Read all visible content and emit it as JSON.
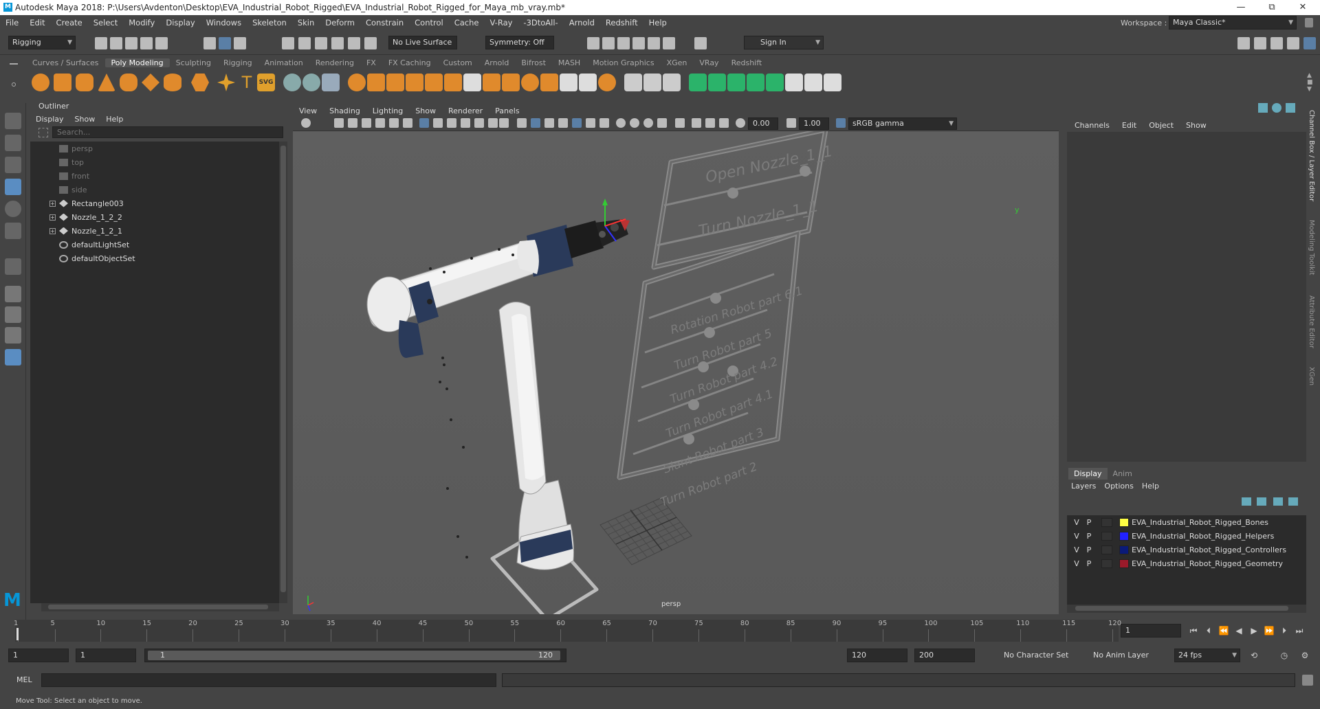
{
  "titlebar": {
    "title": "Autodesk Maya 2018: P:\\Users\\Avdenton\\Desktop\\EVA_Industrial_Robot_Rigged\\EVA_Industrial_Robot_Rigged_for_Maya_mb_vray.mb*",
    "minimize": "—",
    "maximize": "⧉",
    "close": "✕"
  },
  "menubar": [
    "File",
    "Edit",
    "Create",
    "Select",
    "Modify",
    "Display",
    "Windows",
    "Skeleton",
    "Skin",
    "Deform",
    "Constrain",
    "Control",
    "Cache",
    "V-Ray",
    "-3DtoAll-",
    "Arnold",
    "Redshift",
    "Help"
  ],
  "workspace": {
    "label": "Workspace :",
    "value": "Maya Classic*"
  },
  "statusline": {
    "menuset": "Rigging",
    "live_surface": "No Live Surface",
    "symmetry": "Symmetry: Off",
    "sign_in": "Sign In"
  },
  "shelf_tabs": [
    "Curves / Surfaces",
    "Poly Modeling",
    "Sculpting",
    "Rigging",
    "Animation",
    "Rendering",
    "FX",
    "FX Caching",
    "Custom",
    "Arnold",
    "Bifrost",
    "MASH",
    "Motion Graphics",
    "XGen",
    "VRay",
    "Redshift"
  ],
  "shelf_active": "Poly Modeling",
  "outliner": {
    "title": "Outliner",
    "menu": [
      "Display",
      "Show",
      "Help"
    ],
    "search_placeholder": "Search...",
    "items": [
      {
        "label": "persp",
        "type": "camera",
        "dim": true
      },
      {
        "label": "top",
        "type": "camera",
        "dim": true
      },
      {
        "label": "front",
        "type": "camera",
        "dim": true
      },
      {
        "label": "side",
        "type": "camera",
        "dim": true
      },
      {
        "label": "Rectangle003",
        "type": "transform",
        "expandable": true
      },
      {
        "label": "Nozzle_1_2_2",
        "type": "transform",
        "expandable": true
      },
      {
        "label": "Nozzle_1_2_1",
        "type": "transform",
        "expandable": true
      },
      {
        "label": "defaultLightSet",
        "type": "set"
      },
      {
        "label": "defaultObjectSet",
        "type": "set"
      }
    ]
  },
  "viewport": {
    "menu": [
      "View",
      "Shading",
      "Lighting",
      "Show",
      "Renderer",
      "Panels"
    ],
    "exposure": "0.00",
    "gamma": "1.00",
    "color_space": "sRGB gamma",
    "camera_label": "persp",
    "panel_labels": [
      "Open Nozzle_1_1",
      "Turn Nozzle_1_1",
      "Rotation Robot part 6.1",
      "Turn Robot part 5",
      "Turn Robot part 4.2",
      "Turn Robot part 4.1",
      "Slant Robot part 3",
      "Turn Robot part 2"
    ],
    "axis_labels": {
      "x": "x",
      "y": "y",
      "z": "z"
    }
  },
  "channel_box": {
    "menu": [
      "Channels",
      "Edit",
      "Object",
      "Show"
    ]
  },
  "side_tabs": [
    "Channel Box / Layer Editor",
    "Modeling Toolkit",
    "Attribute Editor",
    "XGen"
  ],
  "layer_editor": {
    "tabs": [
      "Display",
      "Anim"
    ],
    "active_tab": "Display",
    "menu": [
      "Layers",
      "Options",
      "Help"
    ],
    "layers": [
      {
        "v": "V",
        "p": "P",
        "color": "#ffff44",
        "name": "EVA_Industrial_Robot_Rigged_Bones"
      },
      {
        "v": "V",
        "p": "P",
        "color": "#2222ff",
        "name": "EVA_Industrial_Robot_Rigged_Helpers"
      },
      {
        "v": "V",
        "p": "P",
        "color": "#0a1a7a",
        "name": "EVA_Industrial_Robot_Rigged_Controllers"
      },
      {
        "v": "V",
        "p": "P",
        "color": "#9a1a2a",
        "name": "EVA_Industrial_Robot_Rigged_Geometry"
      }
    ]
  },
  "timeline": {
    "ticks": [
      "1",
      "5",
      "10",
      "15",
      "20",
      "25",
      "30",
      "35",
      "40",
      "45",
      "50",
      "55",
      "60",
      "65",
      "70",
      "75",
      "80",
      "85",
      "90",
      "95",
      "100",
      "105",
      "110",
      "115",
      "120"
    ],
    "current_frame": "1"
  },
  "range": {
    "start": "1",
    "playback_start": "1",
    "slider_start": "1",
    "slider_end": "120",
    "playback_end": "120",
    "end": "200",
    "character_set": "No Character Set",
    "anim_layer": "No Anim Layer",
    "fps": "24 fps"
  },
  "command_line": {
    "label": "MEL"
  },
  "status": {
    "message": "Move Tool: Select an object to move."
  }
}
